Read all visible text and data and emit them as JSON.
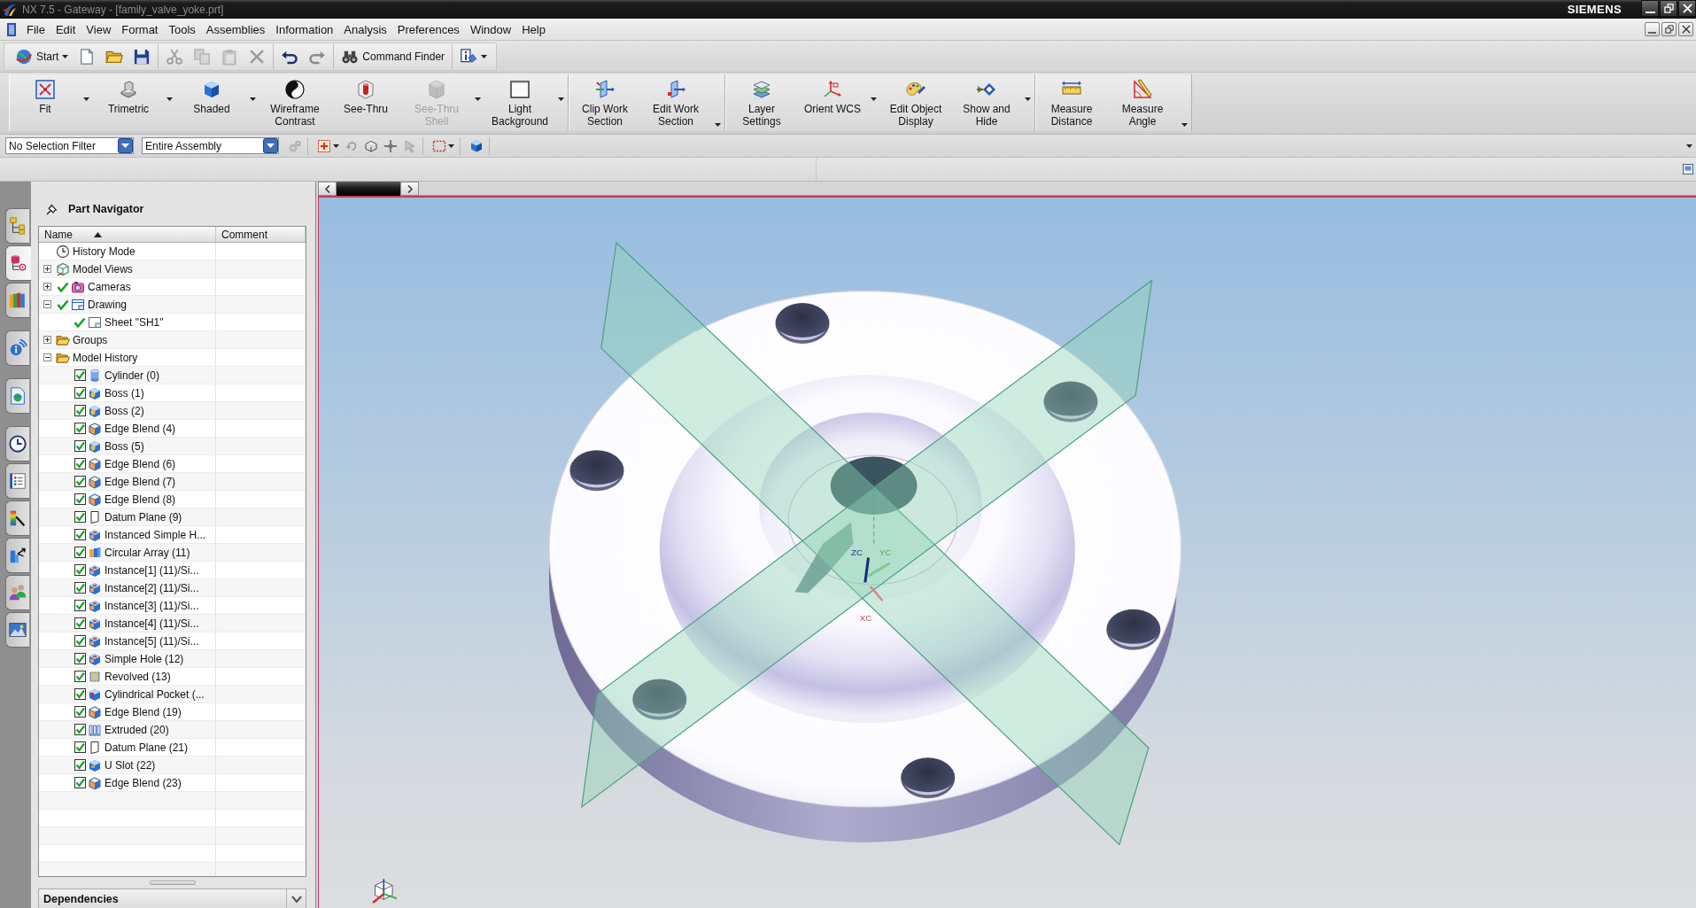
{
  "window": {
    "title": "NX 7.5 - Gateway - [family_valve_yoke.prt]",
    "brand": "SIEMENS"
  },
  "menu_bar": {
    "items": [
      "File",
      "Edit",
      "View",
      "Format",
      "Tools",
      "Assemblies",
      "Information",
      "Analysis",
      "Preferences",
      "Window",
      "Help"
    ]
  },
  "standard_toolbar": {
    "groups": [
      {
        "items": [
          {
            "label": "Start",
            "dropdown": true,
            "disabled": false
          },
          {
            "disabled": false
          },
          {
            "disabled": false
          },
          {
            "disabled": false
          }
        ]
      },
      {
        "items": [
          {
            "disabled": true
          },
          {
            "disabled": true
          },
          {
            "disabled": true
          },
          {
            "disabled": true
          }
        ]
      },
      {
        "items": [
          {
            "disabled": false
          },
          {
            "disabled": true
          }
        ]
      },
      {
        "items": [
          {
            "label": "Command Finder",
            "disabled": false
          }
        ]
      },
      {
        "items": [
          {
            "dropdown": true,
            "disabled": false
          }
        ]
      }
    ]
  },
  "view_toolbar": {
    "groups": [
      {
        "items": [
          {
            "label": "Fit",
            "dropdown": true,
            "disabled": false
          },
          {
            "label": "Trimetric",
            "dropdown": true,
            "disabled": false
          },
          {
            "label": "Shaded",
            "dropdown": true,
            "disabled": false
          },
          {
            "label": "Wireframe\nContrast",
            "disabled": false
          },
          {
            "label": "See-Thru",
            "disabled": false
          },
          {
            "label": "See-Thru\nShell",
            "dropdown": true,
            "disabled": true
          },
          {
            "label": "Light\nBackground",
            "dropdown": true,
            "disabled": false
          }
        ]
      },
      {
        "overflow": true,
        "items": [
          {
            "label": "Clip Work\nSection",
            "disabled": false
          },
          {
            "label": "Edit Work\nSection",
            "disabled": false
          }
        ]
      },
      {
        "items": [
          {
            "label": "Layer\nSettings",
            "disabled": false
          },
          {
            "label": "Orient WCS",
            "dropdown": true,
            "disabled": false
          },
          {
            "label": "Edit Object\nDisplay",
            "disabled": false
          },
          {
            "label": "Show and\nHide",
            "dropdown": true,
            "disabled": false
          }
        ]
      },
      {
        "overflow": true,
        "items": [
          {
            "label": "Measure\nDistance",
            "disabled": false
          },
          {
            "label": "Measure\nAngle",
            "disabled": false
          }
        ]
      }
    ]
  },
  "selection_bar": {
    "filters": [
      {
        "value": "No Selection Filter"
      },
      {
        "value": "Entire Assembly"
      }
    ],
    "groups": [
      {
        "items": [
          {
            "disabled": true
          }
        ]
      },
      {
        "items": [
          {
            "dropdown": true,
            "disabled": false
          },
          {
            "disabled": true
          },
          {
            "disabled": false
          },
          {
            "disabled": false
          },
          {
            "disabled": true
          }
        ]
      },
      {
        "items": [
          {
            "dropdown": true,
            "disabled": false
          }
        ]
      },
      {
        "items": [
          {
            "disabled": false
          }
        ]
      }
    ]
  },
  "resource_bar": {
    "tabs": [
      {
        "selected": false
      },
      {
        "selected": true
      },
      {
        "selected": false
      },
      {
        "selected": false
      },
      {
        "selected": false
      },
      {
        "selected": false
      },
      {
        "selected": false
      },
      {
        "selected": false
      },
      {
        "selected": false
      },
      {
        "selected": false
      },
      {
        "selected": false
      }
    ]
  },
  "part_navigator": {
    "title": "Part Navigator",
    "columns": [
      {
        "label": "Name",
        "sorted": true
      },
      {
        "label": "Comment",
        "sorted": false
      }
    ],
    "nodes": [
      {
        "label": "History Mode",
        "kind": "clock"
      },
      {
        "label": "Model Views",
        "kind": "views",
        "expanded": false
      },
      {
        "label": "Cameras",
        "kind": "camera",
        "expanded": false,
        "checked": true
      },
      {
        "label": "Drawing",
        "kind": "drawing",
        "expanded": true,
        "checked": true,
        "children": [
          {
            "label": "Sheet \"SH1\"",
            "kind": "sheet",
            "checked": true
          }
        ]
      },
      {
        "label": "Groups",
        "kind": "folder",
        "expanded": false
      },
      {
        "label": "Model History",
        "kind": "folder",
        "expanded": true,
        "children": [
          {
            "label": "Cylinder (0)",
            "kind": "cylinder",
            "checked": true
          },
          {
            "label": "Boss (1)",
            "kind": "boss",
            "checked": true
          },
          {
            "label": "Boss (2)",
            "kind": "boss",
            "checked": true
          },
          {
            "label": "Edge Blend (4)",
            "kind": "blend",
            "checked": true
          },
          {
            "label": "Boss (5)",
            "kind": "boss",
            "checked": true
          },
          {
            "label": "Edge Blend (6)",
            "kind": "blend",
            "checked": true
          },
          {
            "label": "Edge Blend (7)",
            "kind": "blend",
            "checked": true
          },
          {
            "label": "Edge Blend (8)",
            "kind": "blend",
            "checked": true
          },
          {
            "label": "Datum Plane (9)",
            "kind": "datum",
            "checked": true
          },
          {
            "label": "Instanced Simple H...",
            "kind": "hole",
            "checked": true
          },
          {
            "label": "Circular Array (11)",
            "kind": "array",
            "checked": true
          },
          {
            "label": "Instance[1] (11)/Si...",
            "kind": "hole",
            "checked": true
          },
          {
            "label": "Instance[2] (11)/Si...",
            "kind": "hole",
            "checked": true
          },
          {
            "label": "Instance[3] (11)/Si...",
            "kind": "hole",
            "checked": true
          },
          {
            "label": "Instance[4] (11)/Si...",
            "kind": "hole",
            "checked": true
          },
          {
            "label": "Instance[5] (11)/Si...",
            "kind": "hole",
            "checked": true
          },
          {
            "label": "Simple Hole (12)",
            "kind": "hole",
            "checked": true
          },
          {
            "label": "Revolved (13)",
            "kind": "revolve",
            "checked": true
          },
          {
            "label": "Cylindrical Pocket (...",
            "kind": "pocket",
            "checked": true
          },
          {
            "label": "Edge Blend (19)",
            "kind": "blend",
            "checked": true
          },
          {
            "label": "Extruded (20)",
            "kind": "extrude",
            "checked": true
          },
          {
            "label": "Datum Plane (21)",
            "kind": "datum",
            "checked": true
          },
          {
            "label": "U Slot (22)",
            "kind": "slot",
            "checked": true
          },
          {
            "label": "Edge Blend (23)",
            "kind": "blend",
            "checked": true
          }
        ]
      }
    ],
    "footer": {
      "title": "Dependencies",
      "expanded": false
    }
  },
  "graphics_window": {
    "wcs_labels": [
      "ZC",
      "YC",
      "XC"
    ]
  }
}
